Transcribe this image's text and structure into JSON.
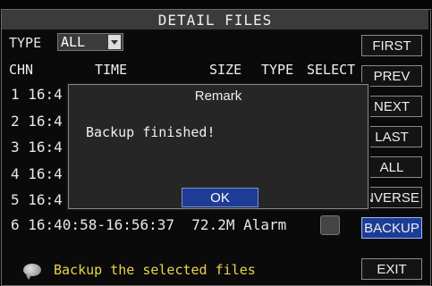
{
  "window": {
    "title": "DETAIL FILES"
  },
  "filter": {
    "type_label": "TYPE",
    "type_value": "ALL"
  },
  "table": {
    "headers": {
      "chn": "CHN",
      "time": "TIME",
      "size": "SIZE",
      "type": "TYPE",
      "select": "SELECT"
    },
    "rows": [
      {
        "text": "1 16:4"
      },
      {
        "text": "2 16:4"
      },
      {
        "text": "3 16:4"
      },
      {
        "text": "4 16:4"
      },
      {
        "text": "5 16:4"
      },
      {
        "text": "6 16:40:58-16:56:37  72.2M Alarm"
      }
    ]
  },
  "buttons": {
    "first": "FIRST",
    "prev": "PREV",
    "next": "NEXT",
    "last": "LAST",
    "all": "ALL",
    "inverse": "NVERSE",
    "backup": "BACKUP",
    "exit": "EXIT"
  },
  "dialog": {
    "title": "Remark",
    "message": "Backup finished!",
    "ok_label": "OK"
  },
  "status": {
    "hint": "Backup the selected files"
  },
  "colors": {
    "accent": "#1e3c96",
    "hint_text": "#e8d44a",
    "title_bar": "#3b3b3b"
  }
}
